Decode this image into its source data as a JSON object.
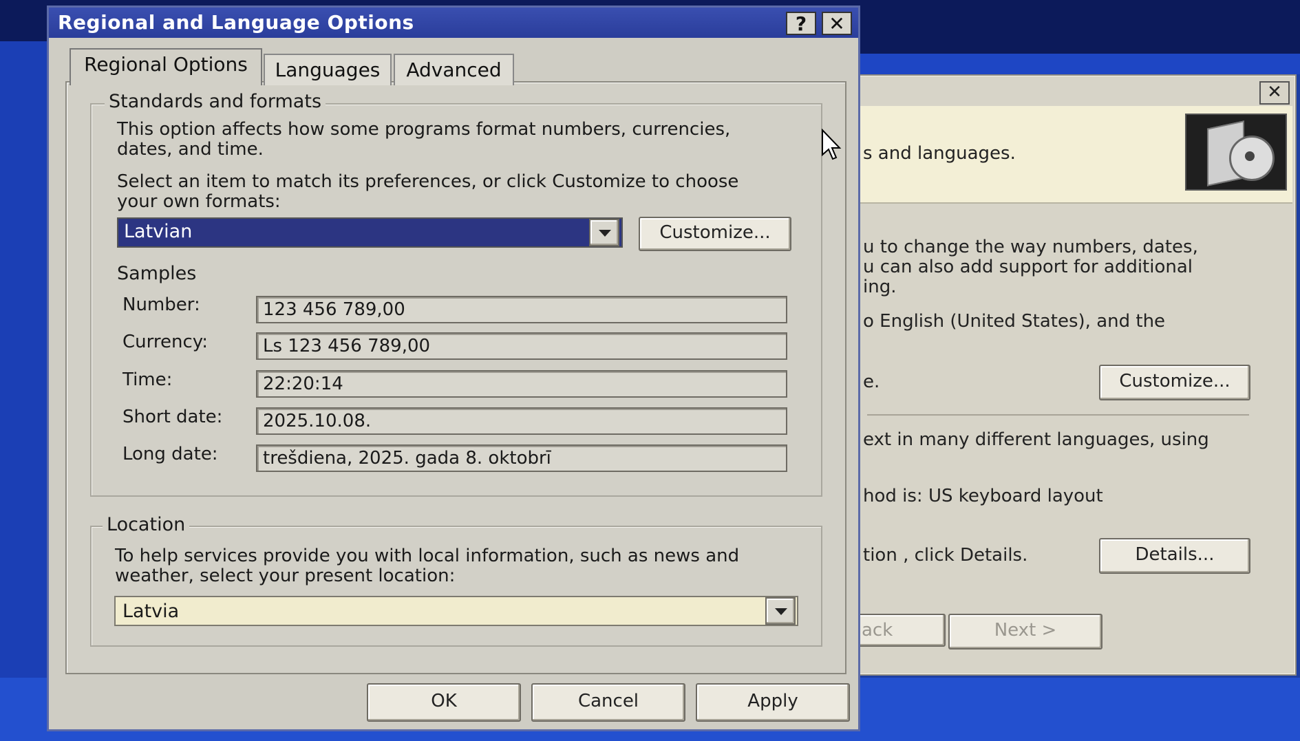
{
  "dialog": {
    "title": "Regional and Language Options",
    "help_glyph": "?",
    "close_glyph": "✕",
    "tabs": [
      {
        "label": "Regional Options",
        "active": true
      },
      {
        "label": "Languages",
        "active": false
      },
      {
        "label": "Advanced",
        "active": false
      }
    ],
    "standards": {
      "legend": "Standards and formats",
      "description": "This option affects how some programs format numbers, currencies, dates, and time.",
      "select_hint": "Select an item to match its preferences, or click Customize to choose your own formats:",
      "selected_format": "Latvian",
      "customize_label": "Customize...",
      "samples_heading": "Samples",
      "samples": [
        {
          "label": "Number:",
          "value": "123 456 789,00"
        },
        {
          "label": "Currency:",
          "value": "Ls 123 456 789,00"
        },
        {
          "label": "Time:",
          "value": "22:20:14"
        },
        {
          "label": "Short date:",
          "value": "2025.10.08."
        },
        {
          "label": "Long date:",
          "value": "trešdiena, 2025. gada 8. oktobrī"
        }
      ]
    },
    "location": {
      "legend": "Location",
      "description": "To help services provide you with local information, such as news and weather, select your present location:",
      "selected_location": "Latvia"
    },
    "buttons": {
      "ok": "OK",
      "cancel": "Cancel",
      "apply": "Apply"
    }
  },
  "background_window": {
    "close_glyph": "✕",
    "header_text": "s and languages.",
    "line1": "u to change the way numbers, dates,",
    "line2": "u can also add support for additional",
    "line3": "ing.",
    "line4": "o English (United States), and the",
    "line5": "e.",
    "customize_label": "Customize...",
    "line6": "ext in many different languages, using",
    "line7": "hod is: US keyboard layout",
    "line8": "tion , click Details.",
    "details_label": "Details...",
    "back_label": "ack",
    "next_label": "Next >"
  },
  "colors": {
    "desktop_blue": "#1d3fa3",
    "titlebar": "#2a3d9b",
    "dialog_face": "#d2d0c7",
    "selected_dropdown": "#2c3582",
    "location_dropdown": "#f1ecce"
  }
}
